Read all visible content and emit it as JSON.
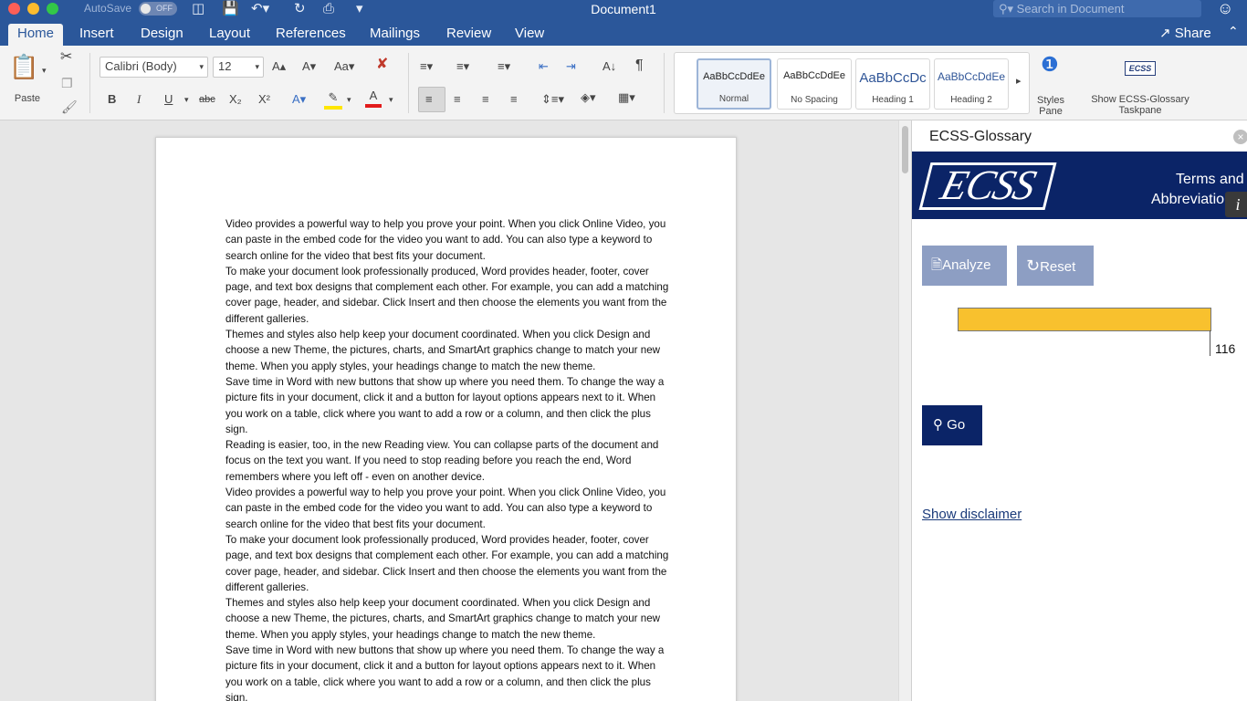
{
  "titlebar": {
    "autosave_label": "AutoSave",
    "autosave_state": "OFF",
    "document_title": "Document1",
    "search_placeholder": "Search in Document"
  },
  "tabs": [
    "Home",
    "Insert",
    "Design",
    "Layout",
    "References",
    "Mailings",
    "Review",
    "View"
  ],
  "active_tab": "Home",
  "share_label": "Share",
  "ribbon": {
    "paste_label": "Paste",
    "font_name": "Calibri (Body)",
    "font_size": "12",
    "styles": [
      {
        "sample": "AaBbCcDdEe",
        "name": "Normal"
      },
      {
        "sample": "AaBbCcDdEe",
        "name": "No Spacing"
      },
      {
        "sample": "AaBbCcDc",
        "name": "Heading 1"
      },
      {
        "sample": "AaBbCcDdEe",
        "name": "Heading 2"
      }
    ],
    "styles_pane_label": "Styles Pane",
    "show_glossary_label": "Show ECSS-Glossary Taskpane"
  },
  "document": {
    "paragraphs": [
      "Video provides a powerful way to help you prove your point. When you click Online Video, you can paste in the embed code for the video you want to add. You can also type a keyword to search online for the video that best fits your document.",
      "To make your document look professionally produced, Word provides header, footer, cover page, and text box designs that complement each other. For example, you can add a matching cover page, header, and sidebar. Click Insert and then choose the elements you want from the different galleries.",
      "Themes and styles also help keep your document coordinated. When you click Design and choose a new Theme, the pictures, charts, and SmartArt graphics change to match your new theme. When you apply styles, your headings change to match the new theme.",
      "Save time in Word with new buttons that show up where you need them. To change the way a picture fits in your document, click it and a button for layout options appears next to it. When you work on a table, click where you want to add a row or a column, and then click the plus sign.",
      "Reading is easier, too, in the new Reading view. You can collapse parts of the document and focus on the text you want. If you need to stop reading before you reach the end, Word remembers where you left off - even on another device.",
      "Video provides a powerful way to help you prove your point. When you click Online Video, you can paste in the embed code for the video you want to add. You can also type a keyword to search online for the video that best fits your document.",
      "To make your document look professionally produced, Word provides header, footer, cover page, and text box designs that complement each other. For example, you can add a matching cover page, header, and sidebar. Click Insert and then choose the elements you want from the different galleries.",
      "Themes and styles also help keep your document coordinated. When you click Design and choose a new Theme, the pictures, charts, and SmartArt graphics change to match your new theme. When you apply styles, your headings change to match the new theme.",
      "Save time in Word with new buttons that show up where you need them. To change the way a picture fits in your document, click it and a button for layout options appears next to it. When you work on a table, click where you want to add a row or a column, and then click the plus sign."
    ]
  },
  "taskpane": {
    "title": "ECSS-Glossary",
    "logo_text": "ECSS",
    "banner_line1": "Terms and",
    "banner_line2": "Abbreviations",
    "analyze_label": "Analyze",
    "reset_label": "Reset",
    "progress_count": "116",
    "progress_fraction": 1.0,
    "go_label": "Go",
    "disclaimer_label": "Show disclaimer"
  },
  "colors": {
    "word_blue": "#2b579a",
    "ecss_navy": "#0b2467",
    "button_gray_blue": "#8d9ec3",
    "progress_yellow": "#f8c12e"
  }
}
